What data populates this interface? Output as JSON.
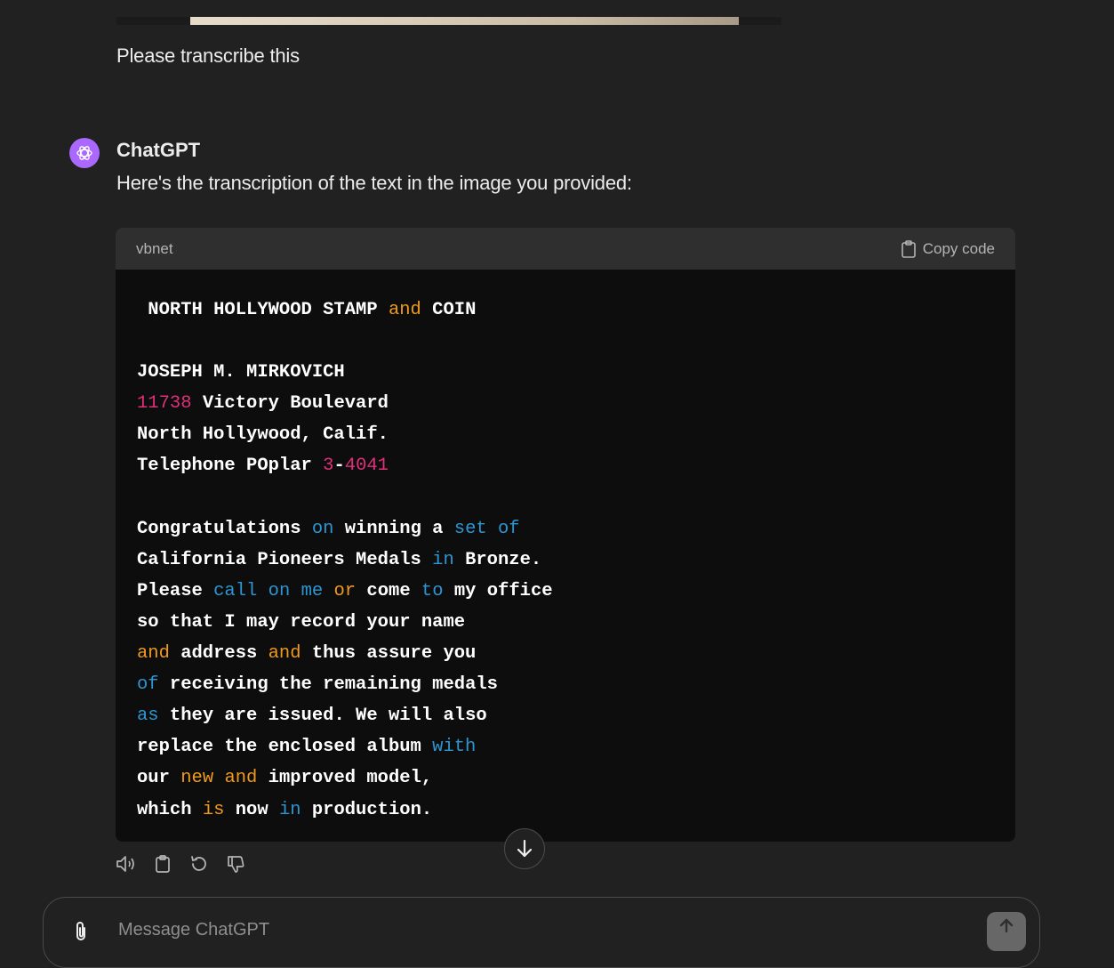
{
  "user_message": "Please transcribe this",
  "assistant": {
    "name": "ChatGPT",
    "intro": "Here's the transcription of the text in the image you provided:"
  },
  "code_block": {
    "language": "vbnet",
    "copy_label": "Copy code",
    "lines": [
      [
        {
          "t": " NORTH HOLLYWOOD STAMP ",
          "c": ""
        },
        {
          "t": "and",
          "c": "kw"
        },
        {
          "t": " COIN",
          "c": ""
        }
      ],
      [],
      [
        {
          "t": "JOSEPH M. MIRKOVICH",
          "c": ""
        }
      ],
      [
        {
          "t": "11738",
          "c": "num"
        },
        {
          "t": " Victory Boulevard",
          "c": ""
        }
      ],
      [
        {
          "t": "North Hollywood, Calif.",
          "c": ""
        }
      ],
      [
        {
          "t": "Telephone POplar ",
          "c": ""
        },
        {
          "t": "3",
          "c": "num"
        },
        {
          "t": "-",
          "c": ""
        },
        {
          "t": "4041",
          "c": "num"
        }
      ],
      [],
      [
        {
          "t": "Congratulations ",
          "c": ""
        },
        {
          "t": "on",
          "c": "bl"
        },
        {
          "t": " winning a ",
          "c": ""
        },
        {
          "t": "set",
          "c": "bl"
        },
        {
          "t": " ",
          "c": ""
        },
        {
          "t": "of",
          "c": "bl"
        }
      ],
      [
        {
          "t": "California Pioneers Medals ",
          "c": ""
        },
        {
          "t": "in",
          "c": "bl"
        },
        {
          "t": " Bronze.",
          "c": ""
        }
      ],
      [
        {
          "t": "Please ",
          "c": ""
        },
        {
          "t": "call",
          "c": "bl"
        },
        {
          "t": " ",
          "c": ""
        },
        {
          "t": "on",
          "c": "bl"
        },
        {
          "t": " ",
          "c": ""
        },
        {
          "t": "me",
          "c": "bl"
        },
        {
          "t": " ",
          "c": ""
        },
        {
          "t": "or",
          "c": "kw"
        },
        {
          "t": " come ",
          "c": ""
        },
        {
          "t": "to",
          "c": "bl"
        },
        {
          "t": " my office",
          "c": ""
        }
      ],
      [
        {
          "t": "so that I may record your name",
          "c": ""
        }
      ],
      [
        {
          "t": "and",
          "c": "kw"
        },
        {
          "t": " address ",
          "c": ""
        },
        {
          "t": "and",
          "c": "kw"
        },
        {
          "t": " thus assure you",
          "c": ""
        }
      ],
      [
        {
          "t": "of",
          "c": "bl"
        },
        {
          "t": " receiving the remaining medals",
          "c": ""
        }
      ],
      [
        {
          "t": "as",
          "c": "bl"
        },
        {
          "t": " they are issued. We will also",
          "c": ""
        }
      ],
      [
        {
          "t": "replace the enclosed album ",
          "c": ""
        },
        {
          "t": "with",
          "c": "bl"
        }
      ],
      [
        {
          "t": "our ",
          "c": ""
        },
        {
          "t": "new",
          "c": "kw"
        },
        {
          "t": " ",
          "c": ""
        },
        {
          "t": "and",
          "c": "kw"
        },
        {
          "t": " improved model,",
          "c": ""
        }
      ],
      [
        {
          "t": "which ",
          "c": ""
        },
        {
          "t": "is",
          "c": "kw"
        },
        {
          "t": " now ",
          "c": ""
        },
        {
          "t": "in",
          "c": "bl"
        },
        {
          "t": " production.",
          "c": ""
        }
      ]
    ]
  },
  "message_actions": [
    {
      "name": "read-aloud-icon"
    },
    {
      "name": "copy-icon"
    },
    {
      "name": "regenerate-icon"
    },
    {
      "name": "thumbs-down-icon"
    }
  ],
  "composer": {
    "placeholder": "Message ChatGPT"
  },
  "colors": {
    "background": "#212121",
    "code_bg": "#0d0d0d",
    "keyword": "#ef9a1d",
    "number": "#df3079",
    "builtin": "#2e95d3",
    "avatar": "#ab68ff"
  }
}
